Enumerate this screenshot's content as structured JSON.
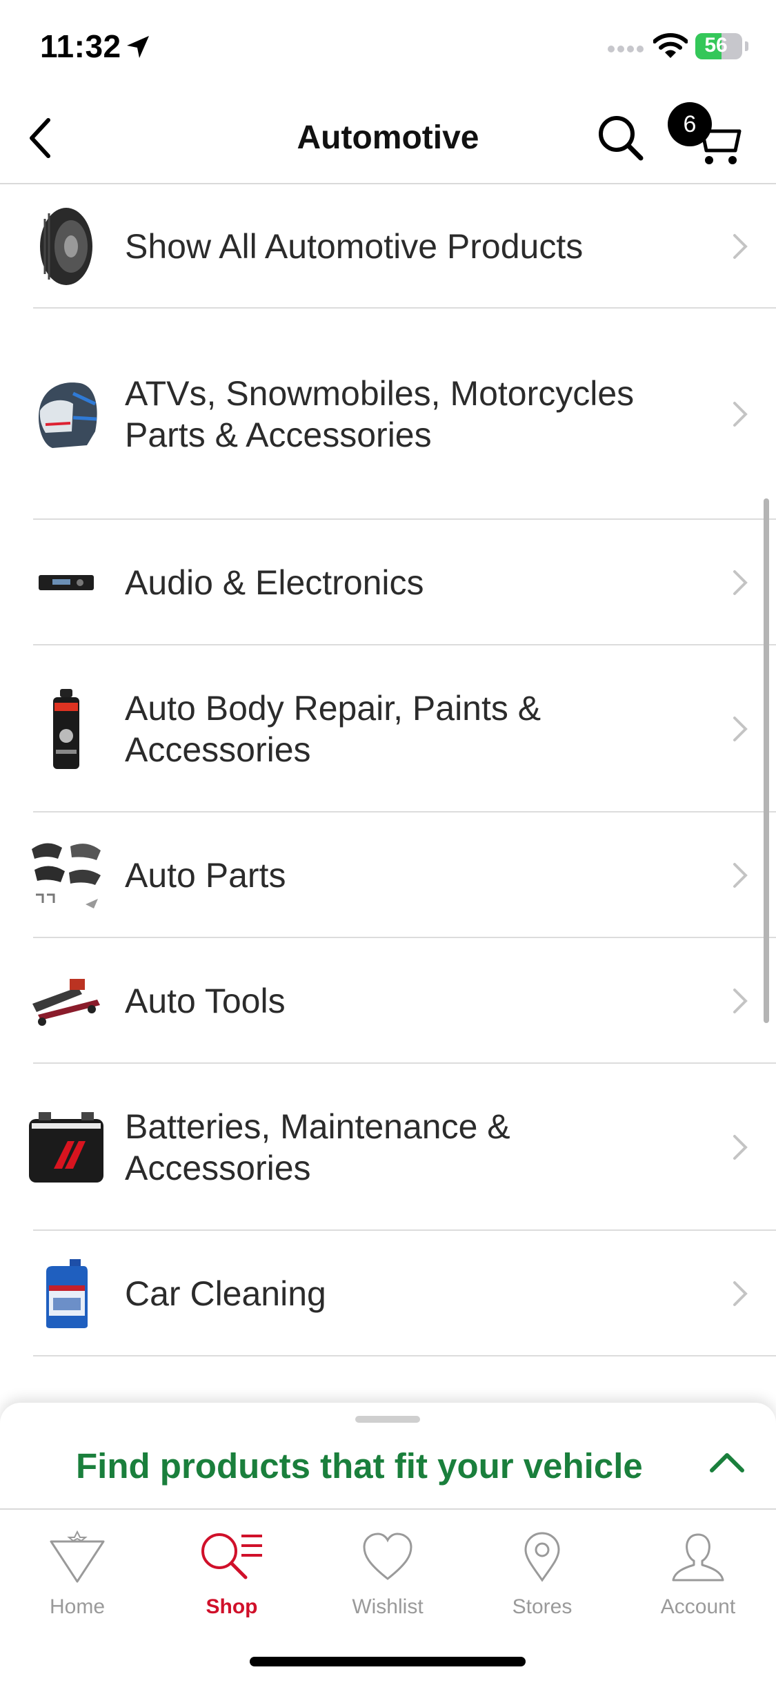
{
  "status_bar": {
    "time": "11:32",
    "battery": "56",
    "battery_level": 0.56
  },
  "nav": {
    "title": "Automotive",
    "cart_count": "6"
  },
  "categories": [
    {
      "label": "Show All Automotive Products",
      "icon": "tire-icon"
    },
    {
      "label": "ATVs, Snowmobiles, Motorcycles Parts & Accessories",
      "icon": "helmet-icon"
    },
    {
      "label": "Audio & Electronics",
      "icon": "car-stereo-icon"
    },
    {
      "label": "Auto Body Repair, Paints & Accessories",
      "icon": "spray-paint-icon"
    },
    {
      "label": "Auto Parts",
      "icon": "brake-pads-icon"
    },
    {
      "label": "Auto Tools",
      "icon": "floor-jack-icon"
    },
    {
      "label": "Batteries, Maintenance & Accessories",
      "icon": "car-battery-icon"
    },
    {
      "label": "Car Cleaning",
      "icon": "washer-fluid-jug-icon"
    }
  ],
  "vehicle_sheet": {
    "text": "Find products that fit your vehicle"
  },
  "tabs": [
    {
      "label": "Home",
      "icon": "home-triangle-icon",
      "active": false
    },
    {
      "label": "Shop",
      "icon": "shop-search-icon",
      "active": true
    },
    {
      "label": "Wishlist",
      "icon": "heart-icon",
      "active": false
    },
    {
      "label": "Stores",
      "icon": "location-pin-icon",
      "active": false
    },
    {
      "label": "Account",
      "icon": "person-icon",
      "active": false
    }
  ],
  "colors": {
    "accent_green": "#1a7f3c",
    "active_red": "#d0102a",
    "inactive_gray": "#9a9a9a"
  }
}
